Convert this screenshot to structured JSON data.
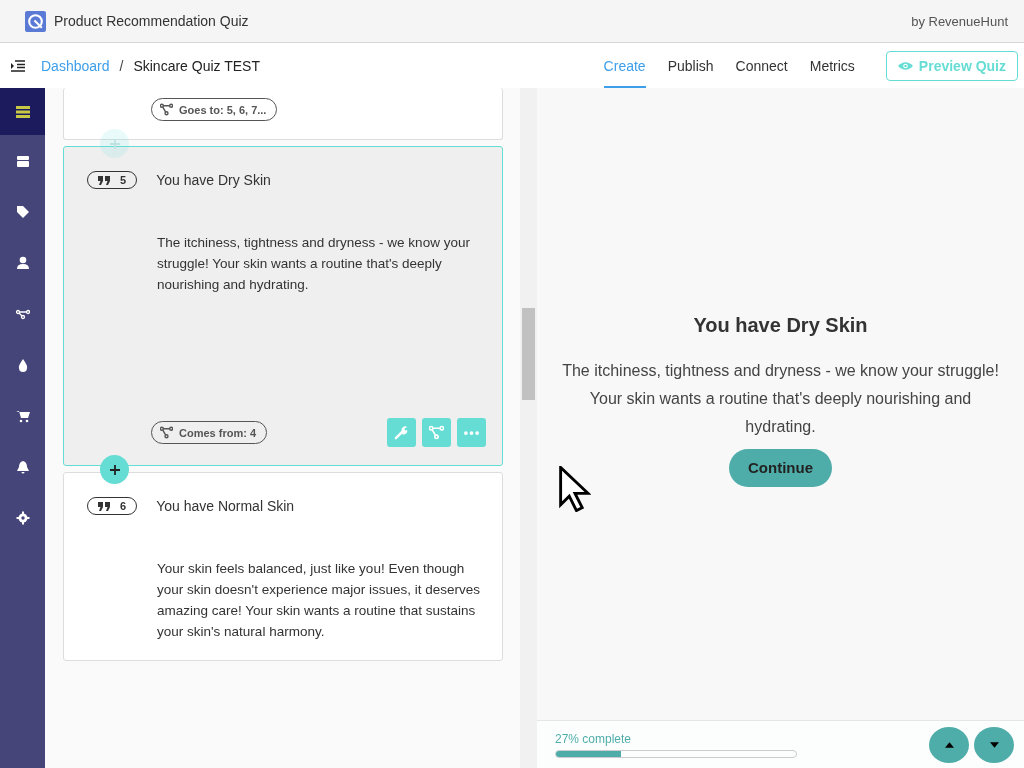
{
  "app": {
    "title": "Product Recommendation Quiz",
    "vendor": "by RevenueHunt"
  },
  "nav": {
    "breadcrumb": [
      {
        "label": "Dashboard",
        "link": true
      },
      {
        "label": "Skincare Quiz TEST",
        "link": false
      }
    ],
    "breadcrumb_separator": "/",
    "tabs": [
      {
        "label": "Create",
        "selected": true
      },
      {
        "label": "Publish",
        "selected": false
      },
      {
        "label": "Connect",
        "selected": false
      },
      {
        "label": "Metrics",
        "selected": false
      }
    ],
    "preview_button": "Preview Quiz"
  },
  "sidebar": {
    "items": [
      {
        "selected": true
      },
      {
        "selected": false
      },
      {
        "selected": false
      },
      {
        "selected": false
      },
      {
        "selected": false
      },
      {
        "selected": false
      },
      {
        "selected": false
      },
      {
        "selected": false
      },
      {
        "selected": false
      }
    ]
  },
  "cards": [
    {
      "link": "Goes to: 5, 6, 7...",
      "selected": false,
      "add_below_active": false
    },
    {
      "number": "5",
      "title": "You have Dry Skin",
      "body": "The itchiness, tightness and dryness - we know your struggle! Your skin wants a routine that's deeply nourishing and hydrating.",
      "link": "Comes from: 4",
      "selected": true,
      "add_below_active": true
    },
    {
      "number": "6",
      "title": "You have Normal Skin",
      "body": "Your skin feels balanced, just like you! Even though your skin doesn't experience major issues, it deserves amazing care! Your skin wants a routine that sustains your skin's natural harmony.",
      "selected": false
    }
  ],
  "preview": {
    "title": "You have Dry Skin",
    "body": "The itchiness, tightness and dryness - we know your struggle! Your skin wants a routine that's deeply nourishing and hydrating.",
    "button": "Continue",
    "progress": {
      "label": "27% complete",
      "level": 0.27
    }
  }
}
